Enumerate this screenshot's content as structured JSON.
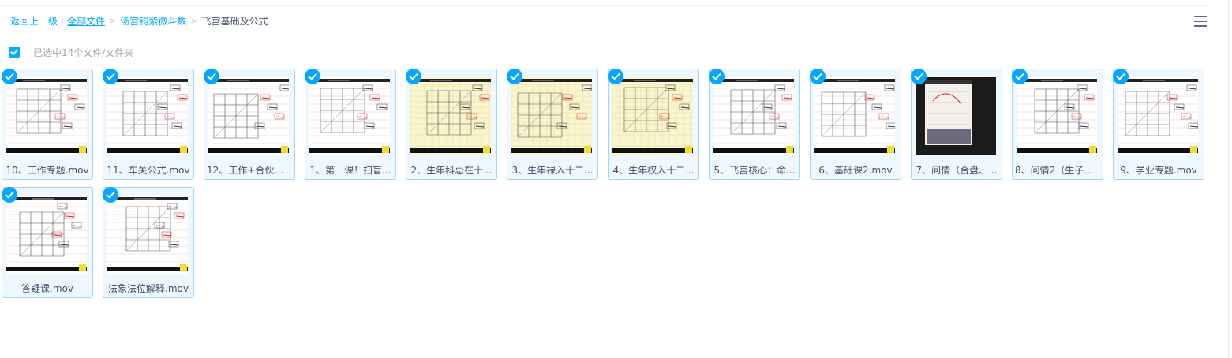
{
  "breadcrumb": {
    "back": "返回上一级",
    "all_files": "全部文件",
    "parent": "汤宫钧紫微斗数",
    "current": "飞宫基础及公式",
    "sep": ">",
    "pipe": "|"
  },
  "toolbar": {
    "menu_icon": "hamburger-menu-icon"
  },
  "selection": {
    "checked": true,
    "text": "已选中14个文件/文件夹"
  },
  "colors": {
    "accent": "#06a7ff",
    "card_border": "#9ed7f7",
    "card_bg": "#f0f8ff"
  },
  "files": [
    {
      "name": "10、工作专题.mov",
      "selected": true,
      "style": "white"
    },
    {
      "name": "11、车关公式.mov",
      "selected": true,
      "style": "white"
    },
    {
      "name": "12、工作+合伙分...",
      "selected": true,
      "style": "white"
    },
    {
      "name": "1、第一课！扫盲...",
      "selected": true,
      "style": "white"
    },
    {
      "name": "2、生年科忌在十...",
      "selected": true,
      "style": "yellow"
    },
    {
      "name": "3、生年禄入十二...",
      "selected": true,
      "style": "yellow"
    },
    {
      "name": "4、生年权入十二...",
      "selected": true,
      "style": "yellow"
    },
    {
      "name": "5、飞宫核心：命...",
      "selected": true,
      "style": "white"
    },
    {
      "name": "6、基础课2.mov",
      "selected": true,
      "style": "white"
    },
    {
      "name": "7、问情（合盘、...",
      "selected": true,
      "style": "dark"
    },
    {
      "name": "8、问情2（生子、...",
      "selected": true,
      "style": "white"
    },
    {
      "name": "9、学业专题.mov",
      "selected": true,
      "style": "white"
    },
    {
      "name": "答疑课.mov",
      "selected": true,
      "style": "white"
    },
    {
      "name": "法象法位解释.mov",
      "selected": true,
      "style": "white"
    }
  ]
}
